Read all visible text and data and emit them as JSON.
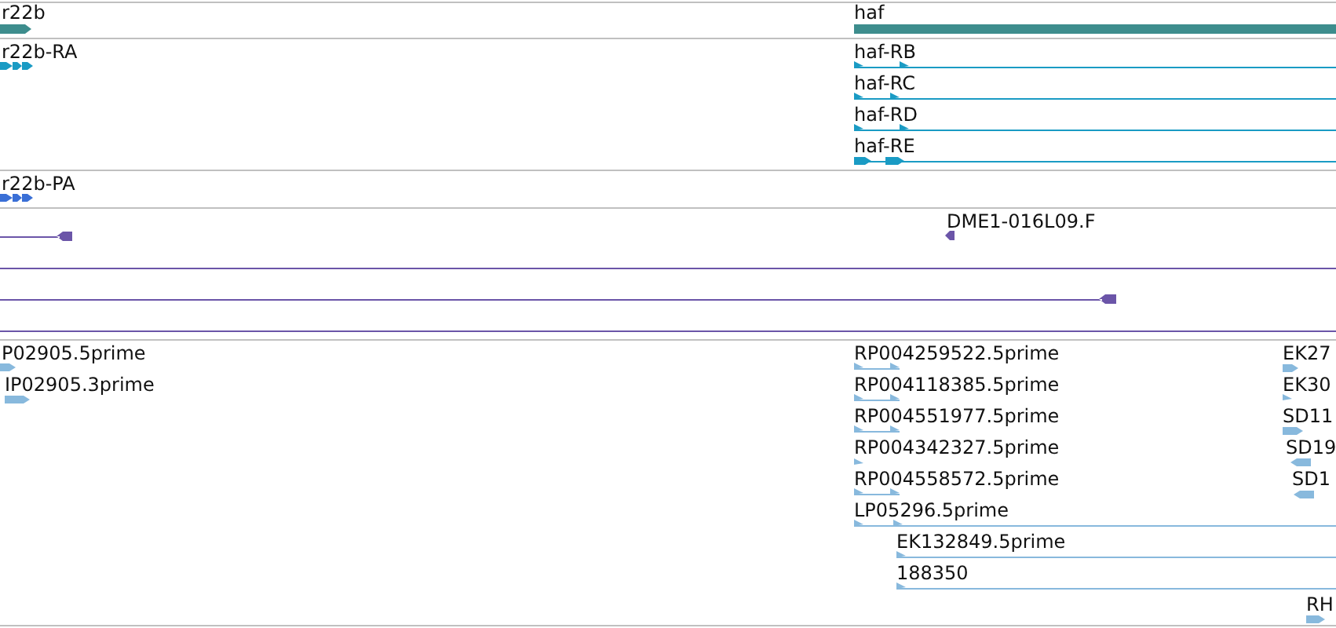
{
  "tracks": [
    {
      "kind": "gene",
      "features": [
        {
          "label": "r22b"
        },
        {
          "label": "haf"
        }
      ]
    },
    {
      "kind": "transcript",
      "features": [
        {
          "label": "r22b-RA"
        },
        {
          "label": "haf-RB"
        },
        {
          "label": "haf-RC"
        },
        {
          "label": "haf-RD"
        },
        {
          "label": "haf-RE"
        }
      ]
    },
    {
      "kind": "protein",
      "features": [
        {
          "label": "r22b-PA"
        }
      ]
    },
    {
      "kind": "clone",
      "features": [
        {
          "label": "DME1-016L09.F"
        }
      ]
    },
    {
      "kind": "est",
      "features": [
        {
          "label": "P02905.5prime"
        },
        {
          "label": "IP02905.3prime"
        },
        {
          "label": "RP004259522.5prime"
        },
        {
          "label": "RP004118385.5prime"
        },
        {
          "label": "RP004551977.5prime"
        },
        {
          "label": "RP004342327.5prime"
        },
        {
          "label": "RP004558572.5prime"
        },
        {
          "label": "LP05296.5prime"
        },
        {
          "label": "EK132849.5prime"
        },
        {
          "label": "188350"
        },
        {
          "label": "EK27"
        },
        {
          "label": "EK30"
        },
        {
          "label": "SD11"
        },
        {
          "label": "SD19"
        },
        {
          "label": "SD1"
        },
        {
          "label": "RH"
        }
      ]
    }
  ]
}
